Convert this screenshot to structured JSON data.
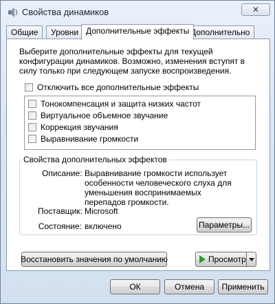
{
  "window": {
    "title": "Свойства динамиков",
    "close_glyph": "✕"
  },
  "tabs": [
    {
      "label": "Общие"
    },
    {
      "label": "Уровни"
    },
    {
      "label": "Дополнительные эффекты",
      "active": true
    },
    {
      "label": "Дополнительно"
    }
  ],
  "panel": {
    "description": "Выберите дополнительные эффекты для текущей конфигурации динамиков. Возможно, изменения вступят в силу только при следующем запуске воспроизведения.",
    "disable_all_label": "Отключить все дополнительные эффекты",
    "disable_all_checked": false,
    "effects": [
      {
        "label": "Тонокомпенсация и защита низких частот",
        "checked": false
      },
      {
        "label": "Виртуальное объемное звучание",
        "checked": false
      },
      {
        "label": "Коррекция звучания",
        "checked": false
      },
      {
        "label": "Выравнивание громкости",
        "checked": false
      }
    ],
    "properties": {
      "legend": "Свойства дополнительных эффектов",
      "description_label": "Описание:",
      "description_value": "Выравнивание громкости использует особенности человеческого слуха для уменьшения воспринимаемых перепадов громкости.",
      "provider_label": "Поставщик:",
      "provider_value": "Microsoft",
      "state_label": "Состояние:",
      "state_value": "включено",
      "settings_button": "Параметры..."
    },
    "restore_defaults_button": "Восстановить значения по умолчанию",
    "preview_button": "Просмотр"
  },
  "footer": {
    "ok": "ОК",
    "cancel": "Отмена",
    "apply": "Применить"
  },
  "colors": {
    "window_bg": "#dbe6f3",
    "panel_bg": "#ffffff",
    "play_green": "#2e9a2e"
  }
}
